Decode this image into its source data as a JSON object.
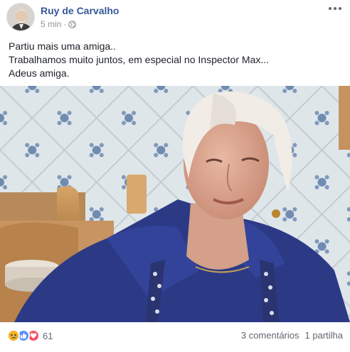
{
  "post": {
    "author": "Ruy de Carvalho",
    "time": "5 min",
    "separator": "·",
    "lines": [
      "Partiu mais uma amiga..",
      "Trabalhamos muito juntos, em especial no Inspector Max...",
      "Adeus amiga."
    ]
  },
  "reactions": {
    "icons": [
      "sad-icon",
      "like-icon",
      "love-icon"
    ],
    "count": "61"
  },
  "stats": {
    "comments": "3 comentários",
    "shares": "1 partilha"
  },
  "colors": {
    "author_link": "#365899",
    "meta": "#90949c",
    "like": "#5890ff",
    "love": "#f25268",
    "sad": "#f7b125"
  }
}
